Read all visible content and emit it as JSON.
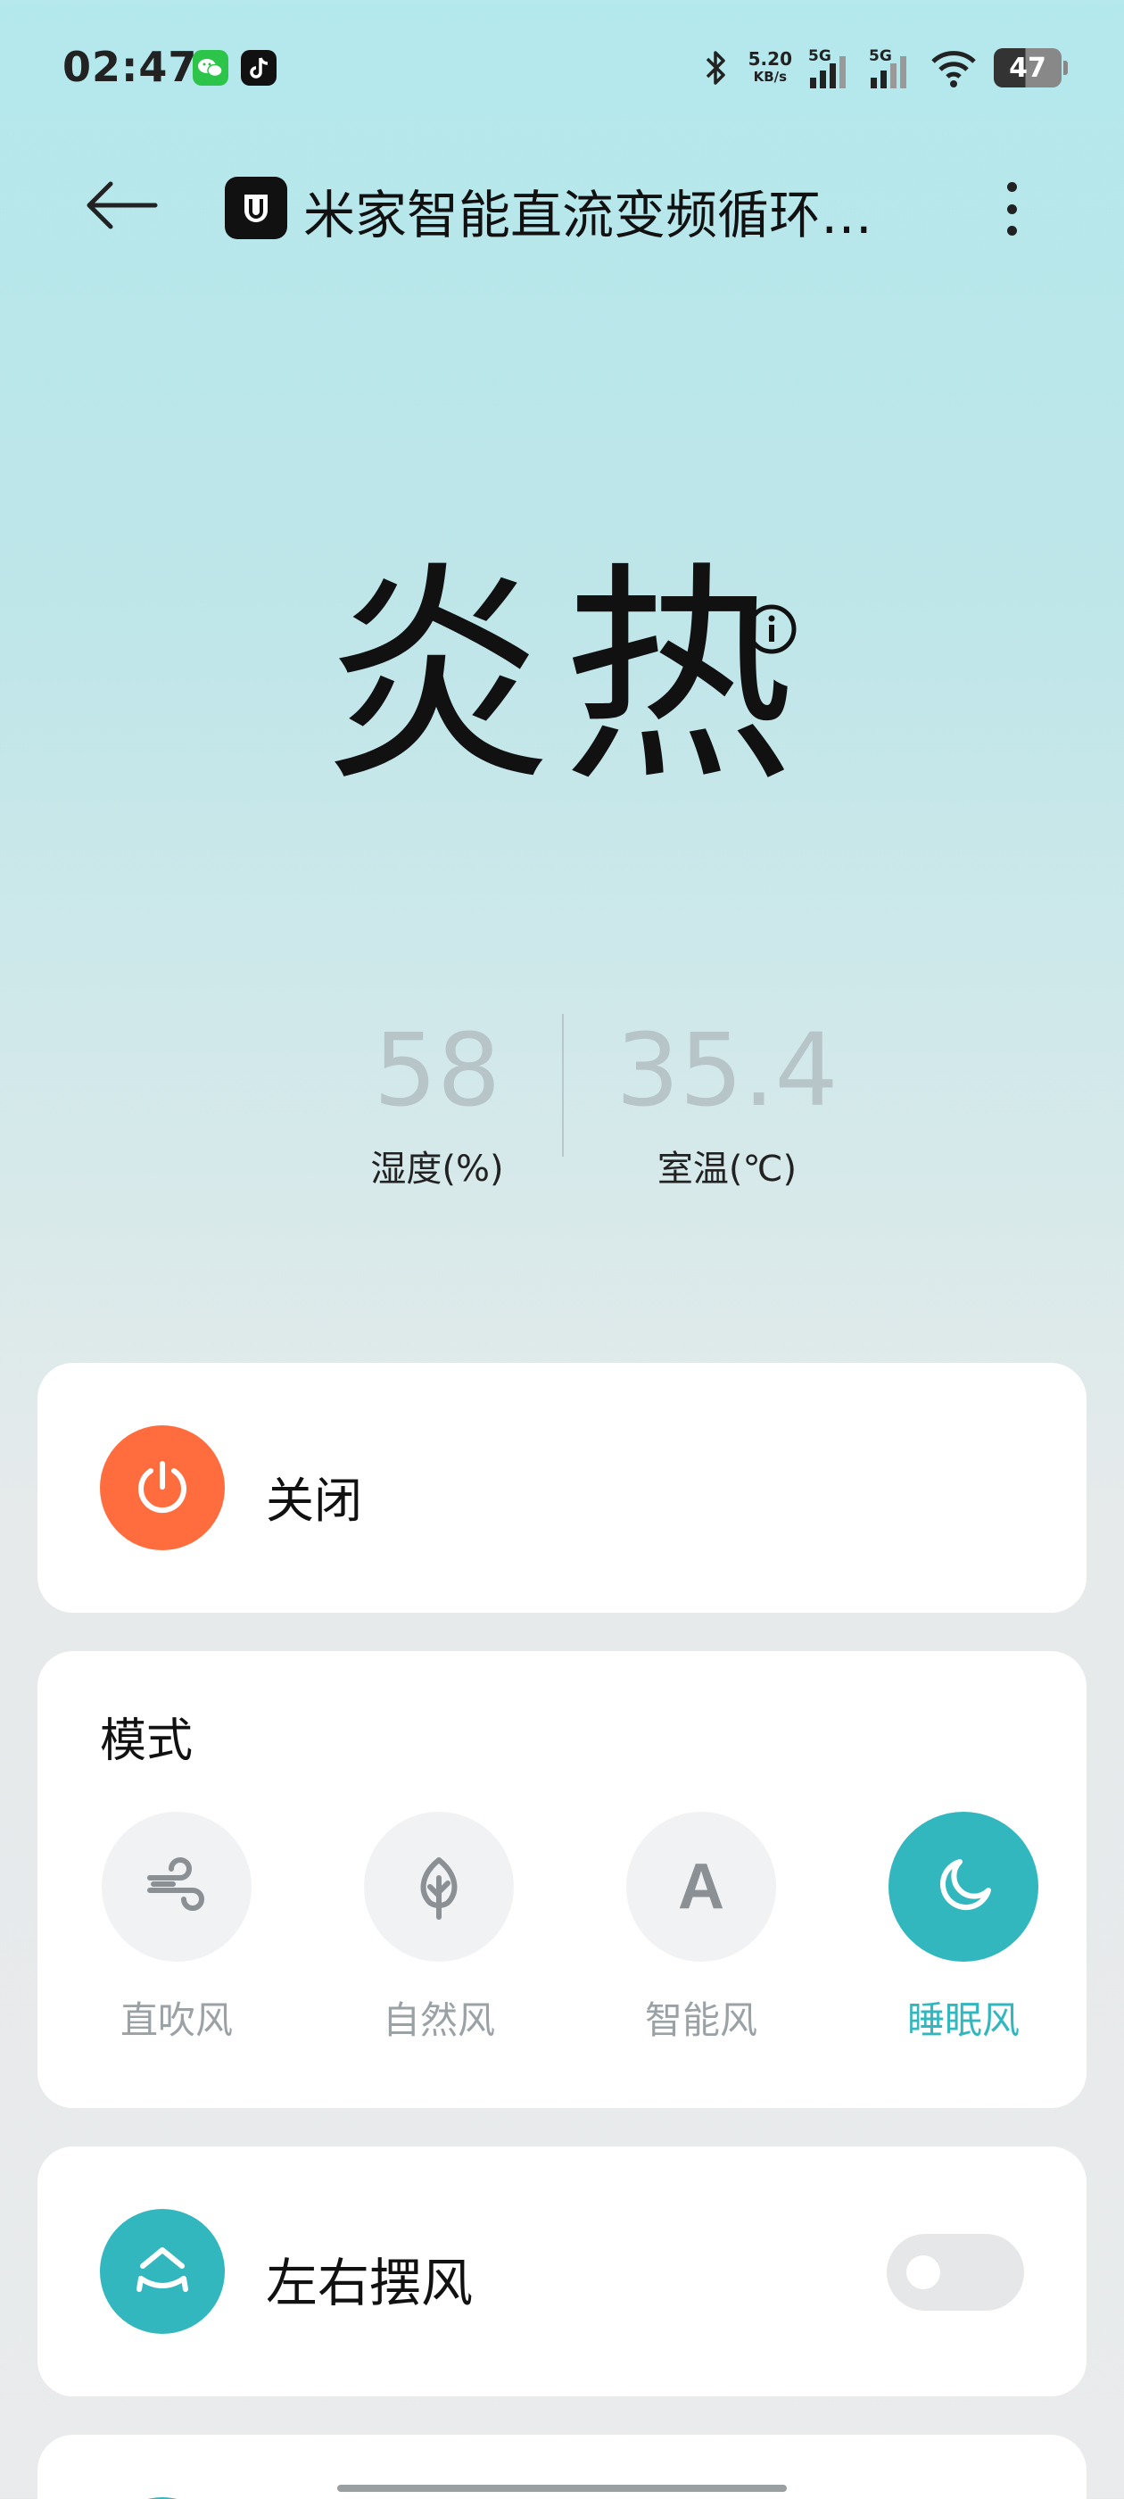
{
  "status_bar": {
    "time": "02:47",
    "net_speed_value": "5.20",
    "net_speed_unit": "KB/s",
    "signal_1": "5G",
    "signal_2": "5G",
    "battery": "47",
    "apps": [
      "wechat-icon",
      "tiktok-icon"
    ]
  },
  "header": {
    "title": "米家智能直流变频循环…",
    "back_icon": "arrow-left-icon",
    "more_icon": "more-vertical-icon"
  },
  "hero": {
    "status": "炎热",
    "humidity_value": "58",
    "humidity_label": "湿度(%)",
    "temperature_value": "35.4",
    "temperature_label": "室温(℃)"
  },
  "power": {
    "label": "关闭",
    "color": "#ff6d3f"
  },
  "mode": {
    "title": "模式",
    "active_color": "#33b7bf",
    "options": [
      {
        "label": "直吹风",
        "icon": "wind-icon",
        "active": false
      },
      {
        "label": "自然风",
        "icon": "leaf-icon",
        "active": false
      },
      {
        "label": "智能风",
        "icon": "letter-a-icon",
        "glyph": "A",
        "active": false
      },
      {
        "label": "睡眠风",
        "icon": "moon-icon",
        "active": true
      }
    ]
  },
  "swing": {
    "label": "左右摆风",
    "enabled": false
  }
}
